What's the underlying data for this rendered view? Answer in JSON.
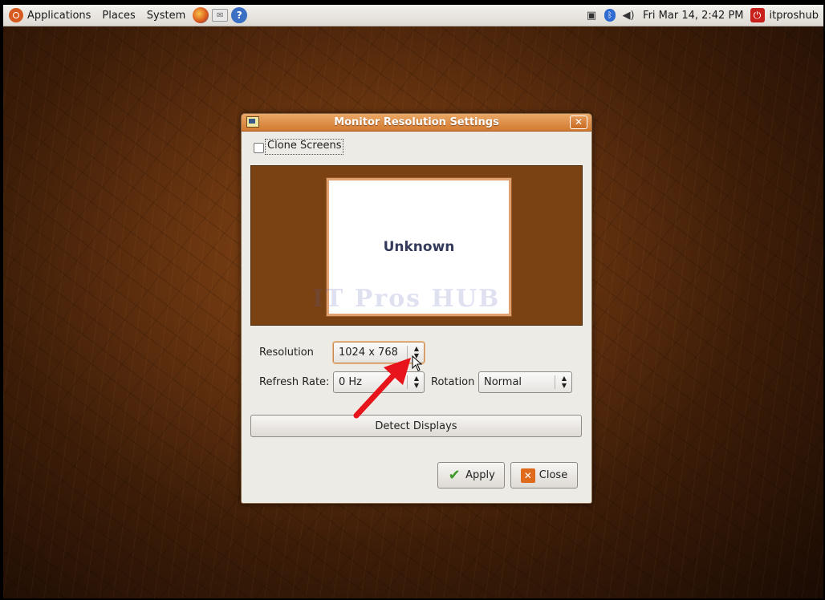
{
  "panel": {
    "menus": [
      "Applications",
      "Places",
      "System"
    ],
    "clock": "Fri Mar 14,  2:42 PM",
    "user": "itproshub"
  },
  "dialog": {
    "title": "Monitor Resolution Settings",
    "clone_screens_label": "Clone Screens",
    "clone_screens_checked": false,
    "monitor_name": "Unknown",
    "watermark": "IT Pros HUB",
    "resolution_label": "Resolution",
    "resolution_value": "1024 x 768",
    "refresh_label": "Refresh Rate:",
    "refresh_value": "0 Hz",
    "rotation_label": "Rotation",
    "rotation_value": "Normal",
    "detect_label": "Detect Displays",
    "apply_label": "Apply",
    "close_label": "Close"
  },
  "colors": {
    "titlebar": "#d27a30",
    "preview_bg": "#7a4213",
    "annotation_arrow": "#e8141b"
  },
  "icons": [
    "ubuntu-logo-icon",
    "firefox-icon",
    "mail-icon",
    "help-icon",
    "network-icon",
    "bluetooth-icon",
    "volume-icon",
    "power-icon",
    "window-icon",
    "close-icon",
    "apply-check-icon",
    "close-x-icon",
    "mouse-cursor-icon"
  ]
}
